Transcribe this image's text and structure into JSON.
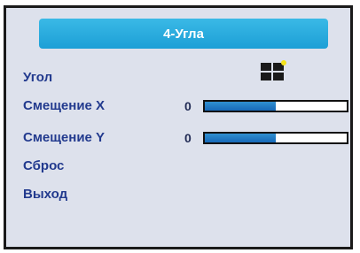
{
  "menu": {
    "title": "4-Угла",
    "items": [
      {
        "label": "Угол",
        "icon": "four-corner-icon"
      },
      {
        "label": "Смещение X",
        "value": "0",
        "slider_fraction": 0.5
      },
      {
        "label": "Смещение Y",
        "value": "0",
        "slider_fraction": 0.5
      },
      {
        "label": "Сброс"
      },
      {
        "label": "Выход"
      }
    ]
  },
  "colors": {
    "title_bar": "#1c9fd6",
    "label_text": "#223a8e",
    "panel_bg": "#dde1ec",
    "slider_fill": "#1769b8",
    "icon_highlight": "#f4e21c"
  }
}
